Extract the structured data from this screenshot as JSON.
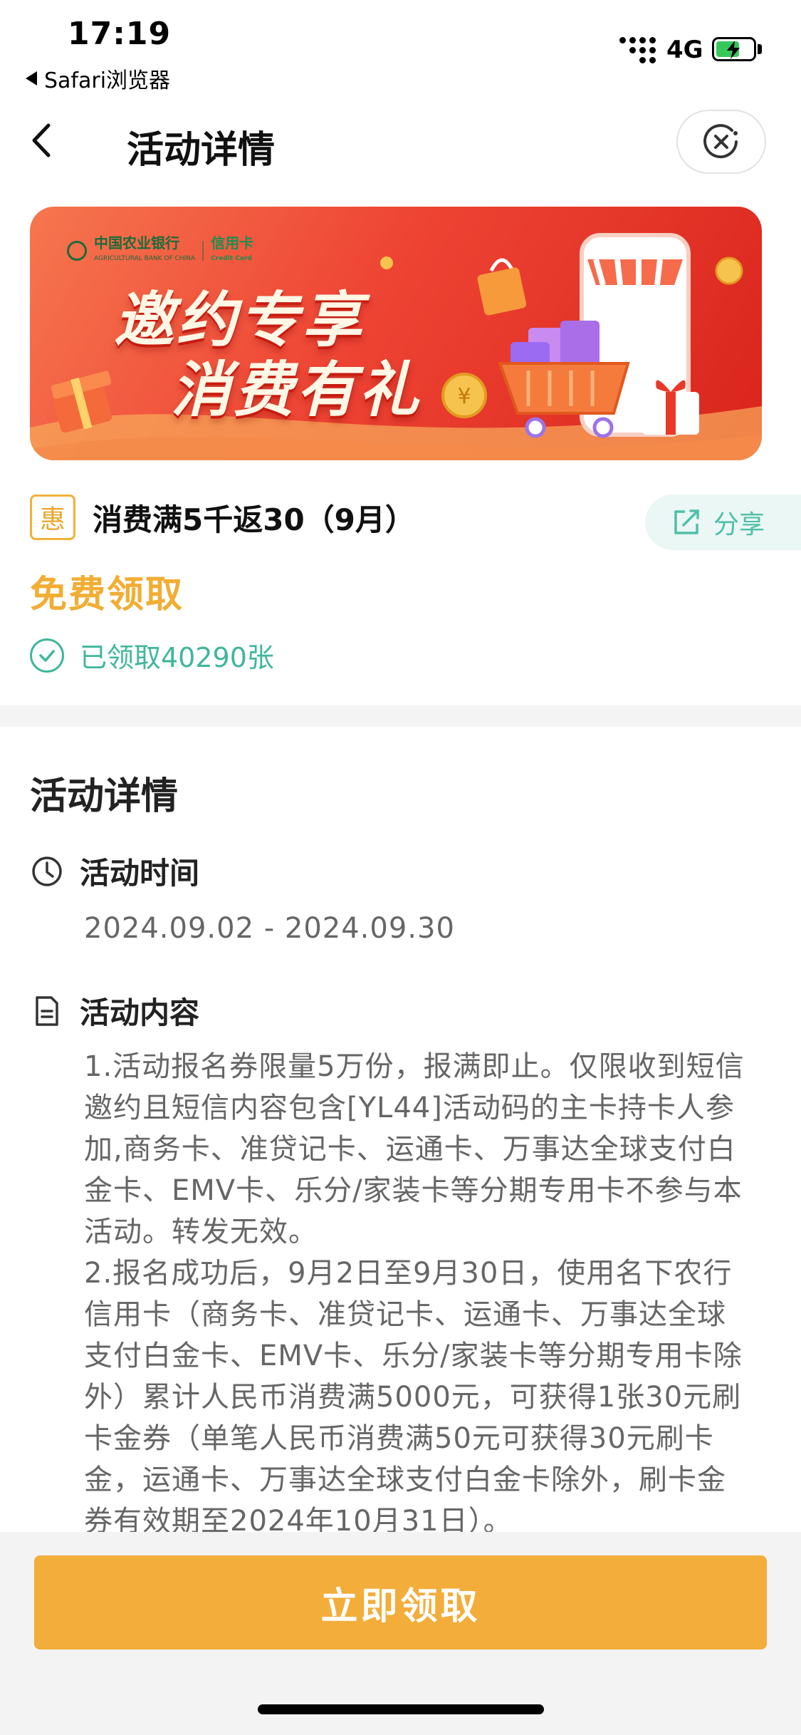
{
  "status_bar": {
    "time": "17:19",
    "back_app": "Safari浏览器",
    "network": "4G"
  },
  "nav": {
    "title": "活动详情"
  },
  "banner": {
    "bank_name": "中国农业银行",
    "bank_name_en": "AGRICULTURAL BANK OF CHINA",
    "card_label": "信用卡",
    "card_label_en": "Credit Card",
    "headline1": "邀约专享",
    "headline2": "消费有礼"
  },
  "coupon": {
    "badge": "惠",
    "title": "消费满5千返30（9月）",
    "share_label": "分享",
    "price_label": "免费领取",
    "claimed_text": "已领取40290张"
  },
  "details": {
    "section_title": "活动详情",
    "time_label": "活动时间",
    "date_range": "2024.09.02 - 2024.09.30",
    "content_label": "活动内容",
    "paragraphs": [
      "1.活动报名券限量5万份，报满即止。仅限收到短信邀约且短信内容包含[YL44]活动码的主卡持卡人参加,商务卡、准贷记卡、运通卡、万事达全球支付白金卡、EMV卡、乐分/家装卡等分期专用卡不参与本活动。转发无效。",
      "2.报名成功后，9月2日至9月30日，使用名下农行信用卡（商务卡、准贷记卡、运通卡、万事达全球支付白金卡、EMV卡、乐分/家装卡等分期专用卡除外）累计人民币消费满5000元，可获得1张30元刷卡金券（单笔人民币消费满50元可获得30元刷卡金，运通卡、万事达全球支付白金卡除外，刷卡金券有效期至2024年10月31日）。"
    ]
  },
  "cta": {
    "label": "立即领取"
  },
  "colors": {
    "accent_orange": "#f2ad3a",
    "accent_teal": "#3fb79b",
    "banner_red": "#ee4434"
  }
}
